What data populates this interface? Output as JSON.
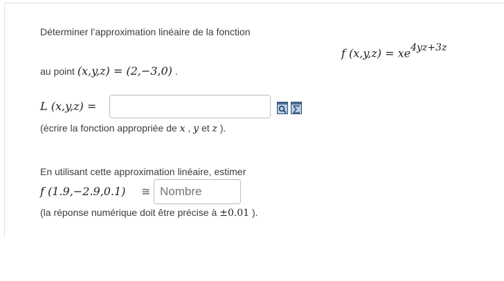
{
  "question": {
    "intro": "Déterminer l’approximation linéaire de la fonction",
    "function_display": "f (x,y,z) = xe",
    "function_exponent": "4yz+3z",
    "point_prefix": "au point",
    "point_math": "(x,y,z) = (2,−3,0)",
    "point_suffix": ".",
    "L_label": "L (x,y,z) =",
    "L_input_value": "",
    "hint_prefix": "(écrire la fonction appropriée de",
    "hint_var_x": "x",
    "hint_comma": ",",
    "hint_var_y": "y",
    "hint_et": "et",
    "hint_var_z": "z",
    "hint_suffix": ").",
    "estimate_text": "En utilisant cette approximation linéaire, estimer",
    "estimate_math": "f (1.9,−2.9,0.1)",
    "approx_symbol": "≅",
    "number_placeholder": "Nombre",
    "precision_prefix": "(la réponse numérique doit être précise à",
    "precision_value": "±0.01",
    "precision_suffix": ")."
  },
  "icons": {
    "preview": "magnifier-icon",
    "equation_editor": "sigma-icon"
  }
}
